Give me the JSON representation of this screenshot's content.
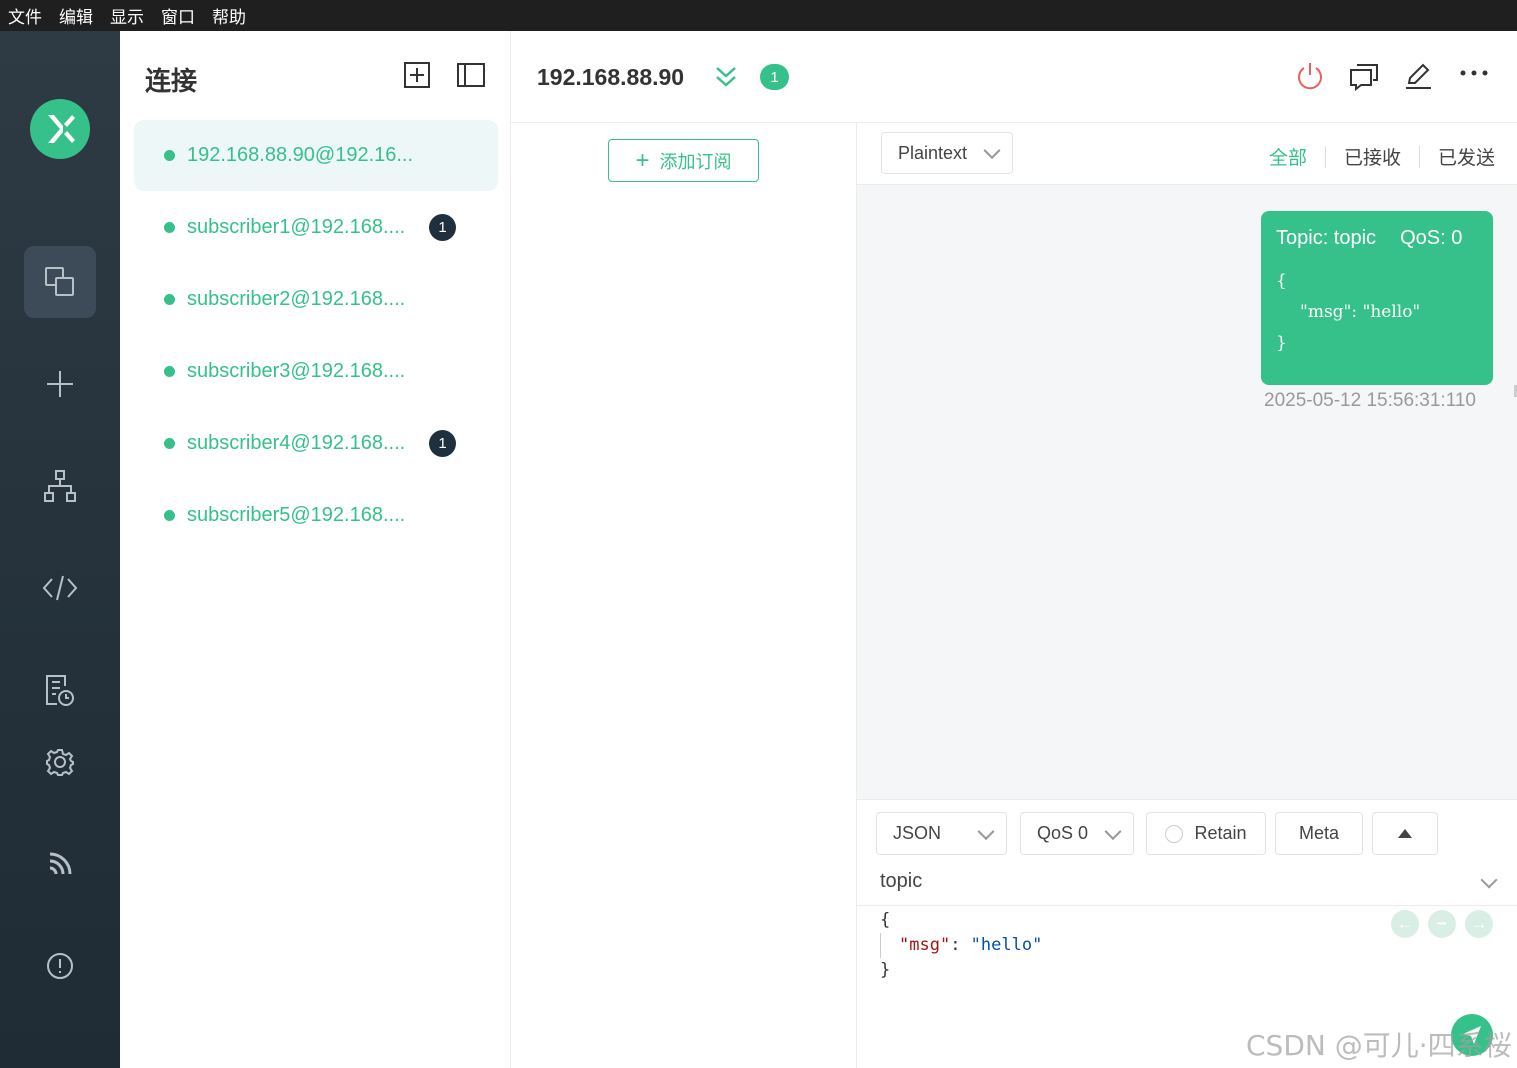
{
  "menu": [
    "文件",
    "编辑",
    "显示",
    "窗口",
    "帮助"
  ],
  "nav": {
    "logo": "mqttx-logo-icon",
    "items": [
      {
        "icon": "connections-icon",
        "active": true
      },
      {
        "icon": "plus-icon"
      },
      {
        "icon": "topology-icon"
      },
      {
        "icon": "script-icon"
      },
      {
        "icon": "log-icon"
      },
      {
        "icon": "gear-icon"
      },
      {
        "icon": "feed-icon"
      },
      {
        "icon": "info-icon"
      }
    ]
  },
  "connections": {
    "title": "连接",
    "items": [
      {
        "name": "192.168.88.90@192.16...",
        "badge": null,
        "active": true
      },
      {
        "name": "subscriber1@192.168....",
        "badge": "1"
      },
      {
        "name": "subscriber2@192.168....",
        "badge": null
      },
      {
        "name": "subscriber3@192.168....",
        "badge": null
      },
      {
        "name": "subscriber4@192.168....",
        "badge": "1"
      },
      {
        "name": "subscriber5@192.168....",
        "badge": null
      }
    ]
  },
  "header": {
    "title": "192.168.88.90",
    "badge": "1",
    "colors": {
      "accent": "#36c18a",
      "disconnect": "#e5635c"
    }
  },
  "subscriptions": {
    "add_label": "添加订阅"
  },
  "message_bar": {
    "format": "Plaintext",
    "filters": {
      "all": "全部",
      "received": "已接收",
      "sent": "已发送"
    },
    "active_filter": "all"
  },
  "messages": [
    {
      "topic_label": "Topic: topic",
      "qos_label": "QoS: 0",
      "payload_open": "{",
      "payload_body": "\"msg\": \"hello\"",
      "payload_close": "}",
      "time": "2025-05-12 15:56:31:110"
    }
  ],
  "publish": {
    "format": "JSON",
    "qos": "QoS 0",
    "retain_label": "Retain",
    "meta_label": "Meta",
    "topic": "topic",
    "payload": {
      "open": "{",
      "key": "\"msg\"",
      "colon": ": ",
      "value": "\"hello\"",
      "close": "}"
    }
  },
  "watermark": "CSDN @可儿·四系桜"
}
